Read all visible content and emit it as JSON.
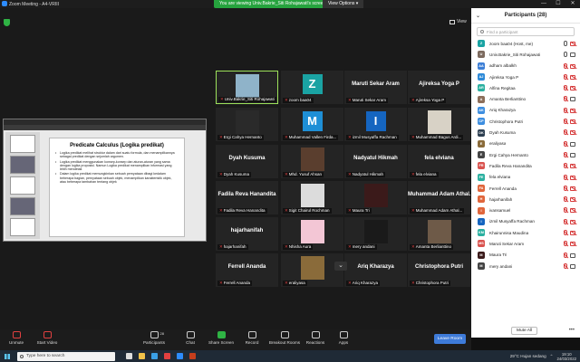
{
  "window": {
    "title": "Zoom Meeting - A4-VRIII",
    "minimize": "—",
    "maximize": "☐",
    "close": "✕"
  },
  "share_banner": "You are viewing Univ.Bakrie_Siti Rohajawati's screen",
  "view_options": "View Options ▾",
  "view_button": "View",
  "shared_slide": {
    "title": "Predicate Calculus (Logika predikat)",
    "bullets": [
      "Logika predikat melihat struktur dalam dari suatu formula, dan menampilkannya sebagai predikat dengan sejumlah argumen.",
      "Logika predikat menggunakan konsep-konsep dan aturan-aturan yang sama dengan logika proposisi. Namun Logika predikat menampilkan informasi yang lebih mendetail.",
      "Dalam logika predikat memungkinkan sebuah pernyataan dibagi kedalam beberapa bagian, pernyataan sebuah objek, menampilkan karakteristik objek, atau beberapa tambahan tentang objek"
    ]
  },
  "tiles": [
    {
      "label": "Univ.Bakrie_Siti Rohajawati",
      "name": "",
      "kind": "photo",
      "color": "#8fb3c9",
      "active": true
    },
    {
      "label": "zoom baa04",
      "name": "",
      "kind": "letter",
      "letter": "Z",
      "color": "#1aa3a3"
    },
    {
      "label": "Maruti Sekar Aram",
      "name": "Maruti Sekar Aram",
      "kind": "text"
    },
    {
      "label": "Ajireksa Yoga P",
      "name": "Ajireksa Yoga P",
      "kind": "text"
    },
    {
      "label": "Ergi Cahya Hernanto",
      "name": "",
      "kind": "photo",
      "color": "#2a2a2a"
    },
    {
      "label": "Muhammad Vallen Firda...",
      "name": "",
      "kind": "letter",
      "letter": "M",
      "color": "#1e8fd6"
    },
    {
      "label": "izmil Musyaffa Rachman",
      "name": "",
      "kind": "letter",
      "letter": "I",
      "color": "#1565c0"
    },
    {
      "label": "Muhammad Bagus Ardi...",
      "name": "",
      "kind": "photo",
      "color": "#d8d2c6"
    },
    {
      "label": "Dyah Kusuma",
      "name": "Dyah Kusuma",
      "kind": "text"
    },
    {
      "label": "Mhd. Yusuf Ahsan",
      "name": "",
      "kind": "photo",
      "color": "#5a3e2e"
    },
    {
      "label": "Nadyatul Hikmah",
      "name": "Nadyatul Hikmah",
      "kind": "text"
    },
    {
      "label": "fela elviana",
      "name": "fela elviana",
      "kind": "text"
    },
    {
      "label": "Fadila Reva Hanandita",
      "name": "Fadila Reva Hanandita",
      "kind": "text"
    },
    {
      "label": "Sigit Chairul Rochman",
      "name": "",
      "kind": "photo",
      "color": "#dcdcdc"
    },
    {
      "label": "Maura Tri",
      "name": "",
      "kind": "photo",
      "color": "#3b1a1a"
    },
    {
      "label": "Muhammad Adam Athal...",
      "name": "Muhammad Adam Athal...",
      "kind": "text"
    },
    {
      "label": "hajarhanifah",
      "name": "hajarhanifah",
      "kind": "text"
    },
    {
      "label": "Nhisha Aura",
      "name": "",
      "kind": "photo",
      "color": "#f3c6d5"
    },
    {
      "label": "mery andani",
      "name": "",
      "kind": "photo",
      "color": "#1a1a1a"
    },
    {
      "label": "Amanta Berlianttino",
      "name": "",
      "kind": "photo",
      "color": "#6e5a48"
    },
    {
      "label": "Ferrell Ananda",
      "name": "Ferrell Ananda",
      "kind": "text"
    },
    {
      "label": "eraliyasa",
      "name": "",
      "kind": "photo",
      "color": "#8a6b3a"
    },
    {
      "label": "Ariq Kharazya",
      "name": "Ariq Kharazya",
      "kind": "text"
    },
    {
      "label": "Christophora Putri",
      "name": "Christophora Putri",
      "kind": "text"
    }
  ],
  "panel": {
    "title": "Participants (28)",
    "search_placeholder": "Find a participant",
    "mute_all": "Mute All",
    "more": "•••",
    "participants": [
      {
        "initials": "Z",
        "name": "zoom baa04 (Host, me)",
        "color": "#1aa3a3",
        "mic": "on",
        "cam": "off"
      },
      {
        "initials": "U",
        "name": "Univ.Bakrie_Siti Rohajawati",
        "color": "#7c6a5e",
        "mic": "on",
        "cam": "on"
      },
      {
        "initials": "AA",
        "name": "adham albalkh",
        "color": "#3d7fd6",
        "mic": "off",
        "cam": "off"
      },
      {
        "initials": "AJ",
        "name": "Ajireksa Yoga P",
        "color": "#2e8ad8",
        "mic": "off",
        "cam": "off"
      },
      {
        "initials": "AR",
        "name": "Alfina Regitaa",
        "color": "#2bb0a0",
        "mic": "off",
        "cam": "off"
      },
      {
        "initials": "A",
        "name": "Amanta Berlianttino",
        "color": "#8c6e5a",
        "mic": "off",
        "cam": "on"
      },
      {
        "initials": "AK",
        "name": "Ariq Kharazya",
        "color": "#3d8ee0",
        "mic": "off",
        "cam": "off"
      },
      {
        "initials": "CP",
        "name": "Christophora Putri",
        "color": "#3d8ee0",
        "mic": "off",
        "cam": "off"
      },
      {
        "initials": "DK",
        "name": "Dyah Kusuma",
        "color": "#2c3e50",
        "mic": "off",
        "cam": "off"
      },
      {
        "initials": "E",
        "name": "eraliyasa",
        "color": "#8a6b3a",
        "mic": "off",
        "cam": "on"
      },
      {
        "initials": "E",
        "name": "Ergi Cahya Hernanto",
        "color": "#444444",
        "mic": "off",
        "cam": "on"
      },
      {
        "initials": "FR",
        "name": "Fadila Reva Hanandita",
        "color": "#d9534f",
        "mic": "off",
        "cam": "off"
      },
      {
        "initials": "FE",
        "name": "fela elviana",
        "color": "#2bb0a0",
        "mic": "off",
        "cam": "off"
      },
      {
        "initials": "FA",
        "name": "Ferrell Ananda",
        "color": "#e0663c",
        "mic": "off",
        "cam": "off"
      },
      {
        "initials": "H",
        "name": "hajarhanifah",
        "color": "#e0663c",
        "mic": "off",
        "cam": "off"
      },
      {
        "initials": "I",
        "name": "ivansamuel",
        "color": "#e0663c",
        "mic": "off",
        "cam": "off"
      },
      {
        "initials": "I",
        "name": "izmil Musyaffa Rachman",
        "color": "#1565c0",
        "mic": "off",
        "cam": "off"
      },
      {
        "initials": "KM",
        "name": "Khairunnisa Maudina",
        "color": "#2bb0a0",
        "mic": "off",
        "cam": "off"
      },
      {
        "initials": "MS",
        "name": "Maruti Sekar Aram",
        "color": "#d9534f",
        "mic": "off",
        "cam": "off"
      },
      {
        "initials": "M",
        "name": "Maura Tri",
        "color": "#3b1a1a",
        "mic": "off",
        "cam": "on"
      },
      {
        "initials": "M",
        "name": "mery andani",
        "color": "#444444",
        "mic": "off",
        "cam": "on"
      }
    ]
  },
  "toolbar": {
    "unmute": "Unmute",
    "start_video": "Start Video",
    "participants": "Participants",
    "participants_count": "28",
    "chat": "Chat",
    "share_screen": "Share Screen",
    "record": "Record",
    "breakout_rooms": "Breakout Rooms",
    "reactions": "Reactions",
    "apps": "Apps",
    "leave": "Leave Room"
  },
  "taskbar": {
    "search_placeholder": "Type here to search",
    "weather": "29°C  Hujan sedang",
    "time": "19:10",
    "date": "24/03/2022"
  }
}
